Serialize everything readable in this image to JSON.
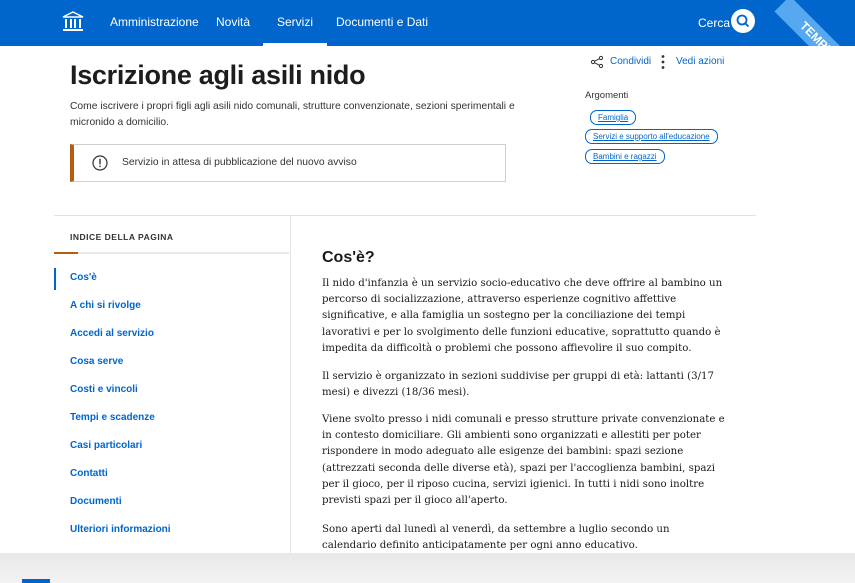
{
  "nav": {
    "items": [
      "Amministrazione",
      "Novità",
      "Servizi",
      "Documenti e Dati"
    ],
    "active_index": 2,
    "search_label": "Cerca"
  },
  "ribbon": {
    "label": "TEMPLATE"
  },
  "header": {
    "title": "Iscrizione agli asili nido",
    "subtitle": "Come iscrivere i propri figli agli asili nido comunali, strutture convenzionate, sezioni sperimentali e micronido a domicilio.",
    "notice": "Servizio in attesa di pubblicazione del nuovo avviso"
  },
  "actions": {
    "share_label": "Condividi",
    "more_label": "Vedi azioni"
  },
  "topics": {
    "heading": "Argomenti",
    "chips": [
      "Famiglia",
      "Servizi e supporto all'educazione",
      "Bambini e ragazzi"
    ]
  },
  "sidebar": {
    "heading": "INDICE DELLA PAGINA",
    "progress": 0.1,
    "items": [
      "Cos'è",
      "A chi si rivolge",
      "Accedi al servizio",
      "Cosa serve",
      "Costi e vincoli",
      "Tempi e scadenze",
      "Casi particolari",
      "Contatti",
      "Documenti",
      "Ulteriori informazioni"
    ]
  },
  "content": {
    "heading": "Cos'è?",
    "paragraphs": [
      "Il nido d'infanzia è un servizio socio-educativo che deve offrire al bambino un percorso di socializzazione, attraverso esperienze cognitivo affettive significative, e alla famiglia un sostegno per la conciliazione dei tempi lavorativi e per lo svolgimento delle funzioni educative, soprattutto quando è impedita da difficoltà o problemi che possono affievolire il suo compito.",
      "Il servizio è organizzato in sezioni suddivise per gruppi di età: lattanti (3/17 mesi) e divezzi (18/36 mesi).",
      "Viene svolto presso i nidi comunali e presso strutture private convenzionate e in contesto domiciliare. Gli ambienti sono organizzati e allestiti per poter rispondere in modo adeguato alle esigenze dei bambini: spazi sezione (attrezzati seconda delle diverse età), spazi per l'accoglienza bambini, spazi per il gioco, per il riposo cucina, servizi igienici. In tutti i nidi sono inoltre previsti spazi per il gioco all'aperto.",
      "Sono aperti dal lunedì al venerdì, da settembre a luglio secondo un calendario definito anticipatamente per ogni anno educativo."
    ]
  },
  "colors": {
    "brand": "#0066cc",
    "accent": "#b35e11"
  }
}
